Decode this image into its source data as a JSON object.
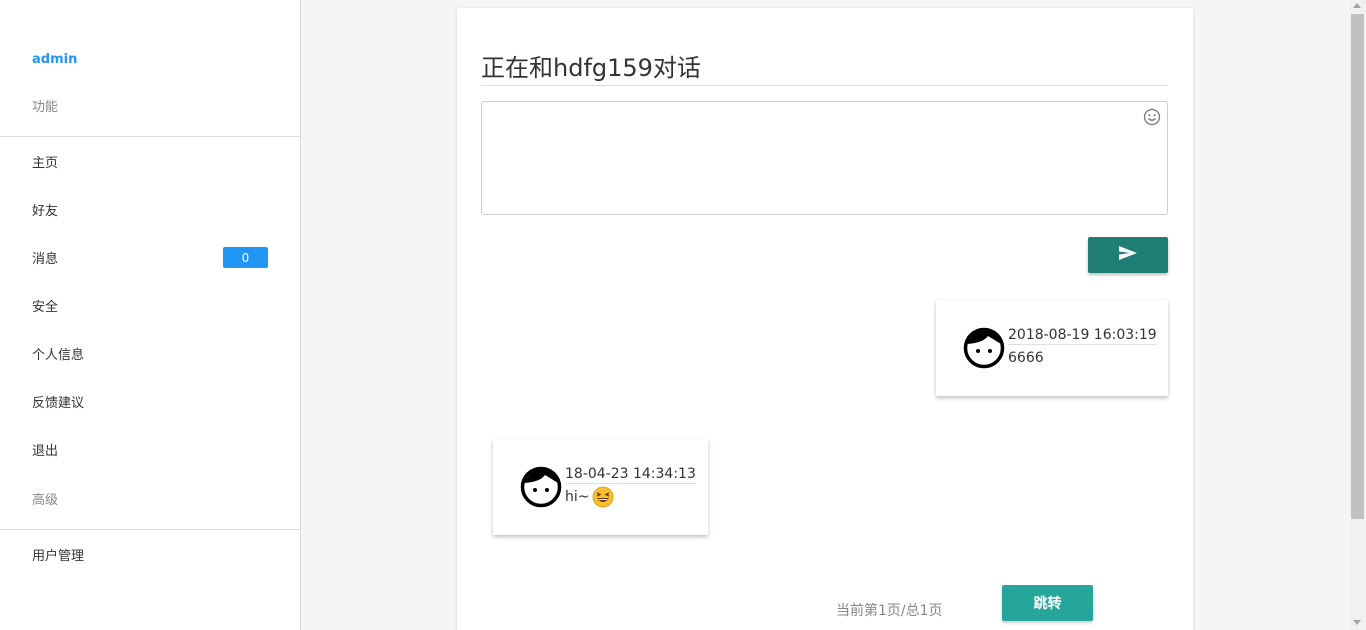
{
  "sidebar": {
    "user": "admin",
    "section_functions": "功能",
    "items": [
      {
        "label": "主页"
      },
      {
        "label": "好友"
      },
      {
        "label": "消息",
        "badge": "0"
      },
      {
        "label": "安全"
      },
      {
        "label": "个人信息"
      },
      {
        "label": "反馈建议"
      },
      {
        "label": "退出"
      }
    ],
    "section_advanced": "高级",
    "admin_items": [
      {
        "label": "用户管理"
      }
    ]
  },
  "chat": {
    "title": "正在和hdfg159对话",
    "input_value": "",
    "icons": {
      "emoji": "smiley-icon",
      "send": "send-icon",
      "avatar": "face-avatar-icon"
    },
    "messages": [
      {
        "time": "2018-08-19 16:03:19",
        "text": "6666",
        "side": "right"
      },
      {
        "time": "18-04-23 14:34:13",
        "text": "hi~",
        "emoji": "laughing-emoji",
        "side": "left"
      }
    ],
    "pagination": {
      "info": "当前第1页/总1页",
      "jump_label": "跳转"
    }
  },
  "colors": {
    "accent_blue": "#2196f3",
    "send_button": "#1f7f74",
    "jump_button": "#26a69a"
  }
}
